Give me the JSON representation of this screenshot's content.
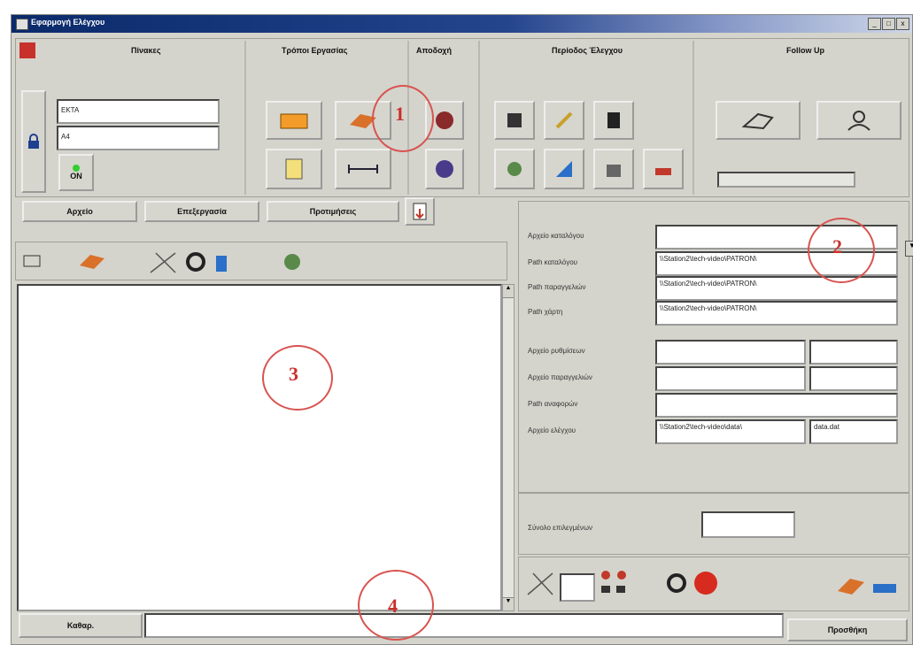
{
  "window": {
    "title": "Εφαρμογή Ελέγχου",
    "min": "_",
    "max": "□",
    "close": "x"
  },
  "toolbar": {
    "group1": "Πίνακες",
    "group2": "Τρόποι Εργασίας",
    "group3": "Αποδοχή",
    "group4": "Περίοδος Έλεγχου",
    "group5": "Follow Up",
    "field1": "ΕΚΤΑ",
    "field2": "Α4",
    "on": "ON"
  },
  "tabs": {
    "tab1": "Αρχείο",
    "tab2": "Επεξεργασία",
    "tab3": "Προτιμήσεις"
  },
  "form": {
    "rows": [
      {
        "label": "Αρχείο καταλόγου",
        "value": ""
      },
      {
        "label": "Path καταλόγου",
        "value": "\\\\Station2\\tech-video\\PATRON\\"
      },
      {
        "label": "Path παραγγελιών",
        "value": "\\\\Station2\\tech-video\\PATRON\\"
      },
      {
        "label": "Path χάρτη",
        "value": "\\\\Station2\\tech-video\\PATRON\\"
      },
      {
        "label": "Αρχείο ρυθμίσεων",
        "value": ""
      },
      {
        "label": "Αρχείο παραγγελιών",
        "value": ""
      },
      {
        "label": "Path αναφορών",
        "value": ""
      },
      {
        "label": "Αρχείο ελέγχου",
        "value": "\\\\Station2\\tech-video\\data\\",
        "value2": "data.dat"
      }
    ],
    "bottom_label": "Σύνολο επιλεγμένων"
  },
  "status": {
    "left": "Καθαρ.",
    "right": "Προσθήκη"
  },
  "annotations": {
    "n1": "1",
    "n2": "2",
    "n3": "3",
    "n4": "4"
  }
}
